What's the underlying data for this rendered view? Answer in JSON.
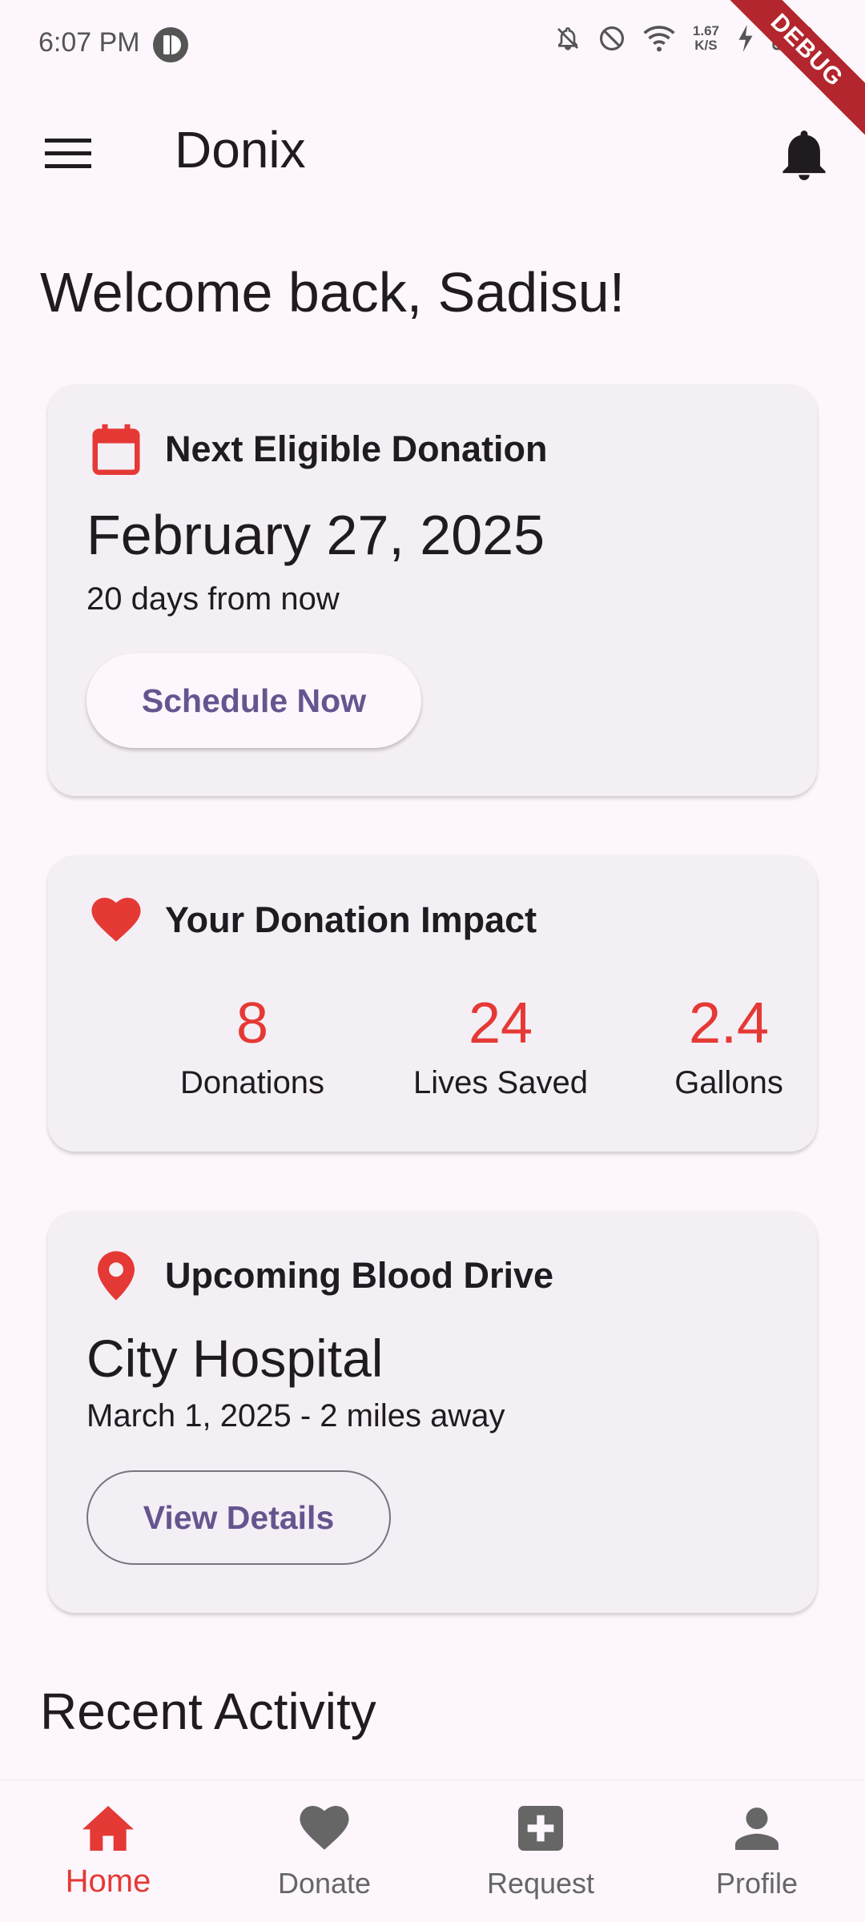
{
  "status_bar": {
    "time": "6:07 PM",
    "net_speed_value": "1.67",
    "net_speed_unit": "K/S",
    "debug_banner": "DEBUG"
  },
  "app_bar": {
    "title": "Donix",
    "menu_icon": "menu-icon",
    "notification_icon": "bell-icon"
  },
  "welcome": "Welcome back, Sadisu!",
  "next_donation": {
    "title": "Next Eligible Donation",
    "icon": "calendar-icon",
    "date": "February 27, 2025",
    "countdown": "20 days from now",
    "button_label": "Schedule Now"
  },
  "impact": {
    "title": "Your Donation Impact",
    "icon": "heart-icon",
    "stats": [
      {
        "value": "8",
        "label": "Donations"
      },
      {
        "value": "24",
        "label": "Lives Saved"
      },
      {
        "value": "2.4",
        "label": "Gallons"
      }
    ]
  },
  "blood_drive": {
    "title": "Upcoming Blood Drive",
    "icon": "location-pin-icon",
    "location": "City Hospital",
    "details": "March 1, 2025 - 2 miles away",
    "button_label": "View Details"
  },
  "recent_activity_title": "Recent Activity",
  "bottom_nav": {
    "items": [
      {
        "label": "Home",
        "icon": "home-icon",
        "active": true
      },
      {
        "label": "Donate",
        "icon": "heart-icon",
        "active": false
      },
      {
        "label": "Request",
        "icon": "medical-plus-icon",
        "active": false
      },
      {
        "label": "Profile",
        "icon": "person-icon",
        "active": false
      }
    ]
  },
  "colors": {
    "accent_red": "#e53935",
    "primary_purple": "#65558f",
    "background": "#fdf7fd",
    "card": "#f4eff5"
  }
}
